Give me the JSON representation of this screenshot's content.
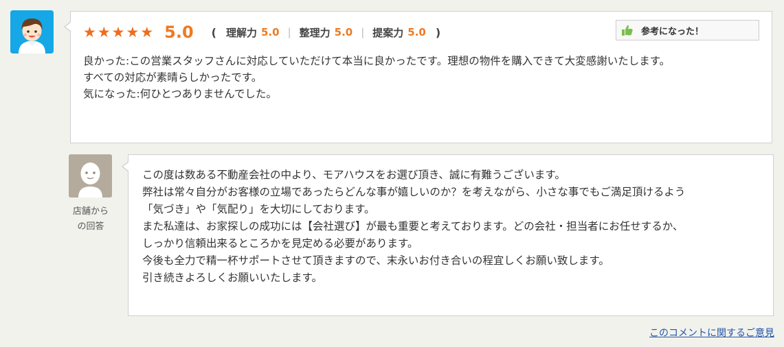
{
  "review": {
    "stars": [
      "★",
      "★",
      "★",
      "★",
      "★"
    ],
    "score": "5.0",
    "open_paren": "(",
    "close_paren": ")",
    "subscores": [
      {
        "label": "理解力",
        "value": "5.0"
      },
      {
        "label": "整理力",
        "value": "5.0"
      },
      {
        "label": "提案力",
        "value": "5.0"
      }
    ],
    "separator": "|",
    "helpful_label": "参考になった！",
    "body_lines": [
      "良かった:この営業スタッフさんに対応していただけて本当に良かったです。理想の物件を購入できて大変感謝いたします。",
      "すべての対応が素晴らしかったです。",
      "気になった:何ひとつありませんでした。"
    ]
  },
  "reply": {
    "caption_line1": "店舗から",
    "caption_line2": "の回答",
    "body_lines": [
      "この度は数ある不動産会社の中より、モアハウスをお選び頂き、誠に有難うございます。",
      "弊社は常々自分がお客様の立場であったらどんな事が嬉しいのか？を考えながら、小さな事でもご満足頂けるよう",
      "「気づき」や「気配り」を大切にしております。",
      "また私達は、お家探しの成功には【会社選び】が最も重要と考えております。どの会社・担当者にお任せするか、",
      "しっかり信頼出来るところかを見定める必要があります。",
      "今後も全力で精一杯サポートさせて頂きますので、末永いお付き合いの程宜しくお願い致します。",
      "引き続きよろしくお願いいたします。"
    ]
  },
  "footer": {
    "feedback_link": "このコメントに関するご意見"
  },
  "colors": {
    "accent_orange": "#ee7a21",
    "user_avatar_bg": "#16a7e6",
    "shop_avatar_bg": "#b5ab9d",
    "link_blue": "#2255aa"
  }
}
